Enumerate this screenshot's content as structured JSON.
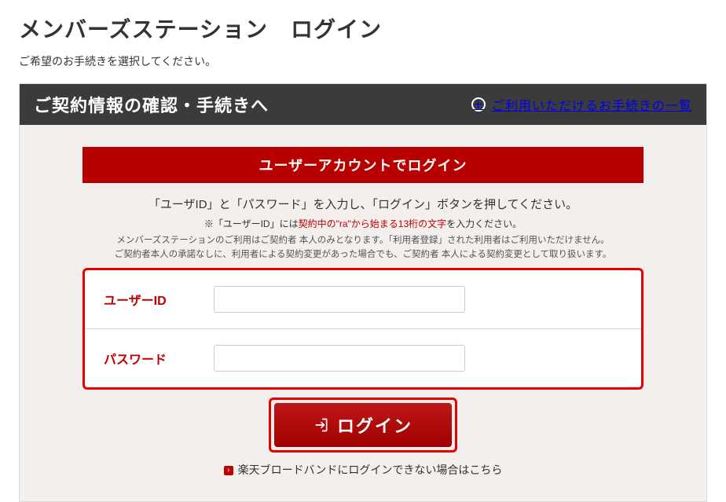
{
  "page": {
    "title": "メンバーズステーション　ログイン",
    "subtitle": "ご希望のお手続きを選択してください。"
  },
  "section": {
    "header_left": "ご契約情報の確認・手続きへ",
    "header_right": "ご利用いただけるお手続きの一覧"
  },
  "login": {
    "heading": "ユーザーアカウントでログイン",
    "instruction_main": "「ユーザID」と「パスワード」を入力し、「ログイン」ボタンを押してください。",
    "instruction_note_prefix": "※「ユーザーID」には",
    "instruction_note_red": "契約中の\"ra\"から始まる13桁の文字",
    "instruction_note_suffix": "を入力ください。",
    "instruction_small1": "メンバーズステーションのご利用はご契約者 本人のみとなります。「利用者登録」された利用者はご利用いただけません。",
    "instruction_small2": "ご契約者本人の承諾なしに、利用者による契約変更があった場合でも、ご契約者 本人による契約変更として取り扱います。",
    "form": {
      "userid_label": "ユーザーID",
      "password_label": "パスワード"
    },
    "button_label": "ログイン",
    "help_link": "楽天ブロードバンドにログインできない場合はこちら"
  }
}
